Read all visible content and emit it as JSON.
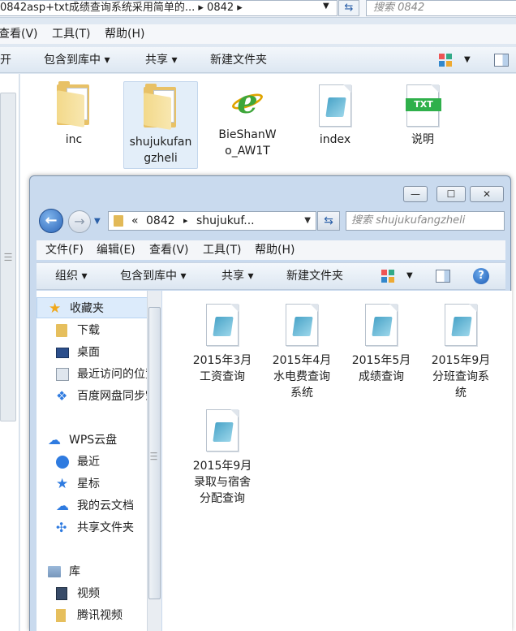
{
  "back_window": {
    "address_text": "0842asp+txt成绩查询系统采用简单的...  ▸  0842  ▸",
    "search_placeholder": "搜索 0842",
    "menu": [
      "查看(V)",
      "工具(T)",
      "帮助(H)"
    ],
    "toolbar": [
      "打开",
      "包含到库中 ▾",
      "共享 ▾",
      "新建文件夹"
    ],
    "items": [
      {
        "label": "inc",
        "icon": "folder-icon"
      },
      {
        "label": "shujukufangzheli",
        "icon": "folder-icon",
        "selected": true
      },
      {
        "label": "BieShanWo_AW1T",
        "icon": "ie-html-icon"
      },
      {
        "label": "index",
        "icon": "document-icon"
      },
      {
        "label": "说明",
        "icon": "txt-file-icon",
        "badge": "TXT"
      }
    ]
  },
  "front_window": {
    "controls": {
      "minimize": "—",
      "maximize": "☐",
      "close": "✕"
    },
    "address": {
      "prefix": "«",
      "crumbs": [
        "0842",
        "▸",
        "shujukuf..."
      ]
    },
    "search_placeholder": "搜索 shujukufangzheli",
    "menu": [
      "文件(F)",
      "编辑(E)",
      "查看(V)",
      "工具(T)",
      "帮助(H)"
    ],
    "toolbar": {
      "organize": "组织 ▾",
      "include": "包含到库中 ▾",
      "share": "共享 ▾",
      "new_folder": "新建文件夹",
      "help": "?"
    },
    "nav": {
      "favorites": {
        "label": "收藏夹",
        "items": [
          "下载",
          "桌面",
          "最近访问的位置",
          "百度网盘同步空间"
        ]
      },
      "wps": {
        "label": "WPS云盘",
        "items": [
          "最近",
          "星标",
          "我的云文档",
          "共享文件夹"
        ]
      },
      "library": {
        "label": "库",
        "items": [
          "视频",
          "腾讯视频"
        ]
      }
    },
    "files": [
      {
        "lines": [
          "2015年3月",
          "工资查询"
        ]
      },
      {
        "lines": [
          "2015年4月",
          "水电费查询",
          "系统"
        ]
      },
      {
        "lines": [
          "2015年5月",
          "成绩查询"
        ]
      },
      {
        "lines": [
          "2015年9月",
          "分班查询系",
          "统"
        ]
      },
      {
        "lines": [
          "2015年9月",
          "录取与宿舍",
          "分配查询"
        ]
      }
    ]
  }
}
